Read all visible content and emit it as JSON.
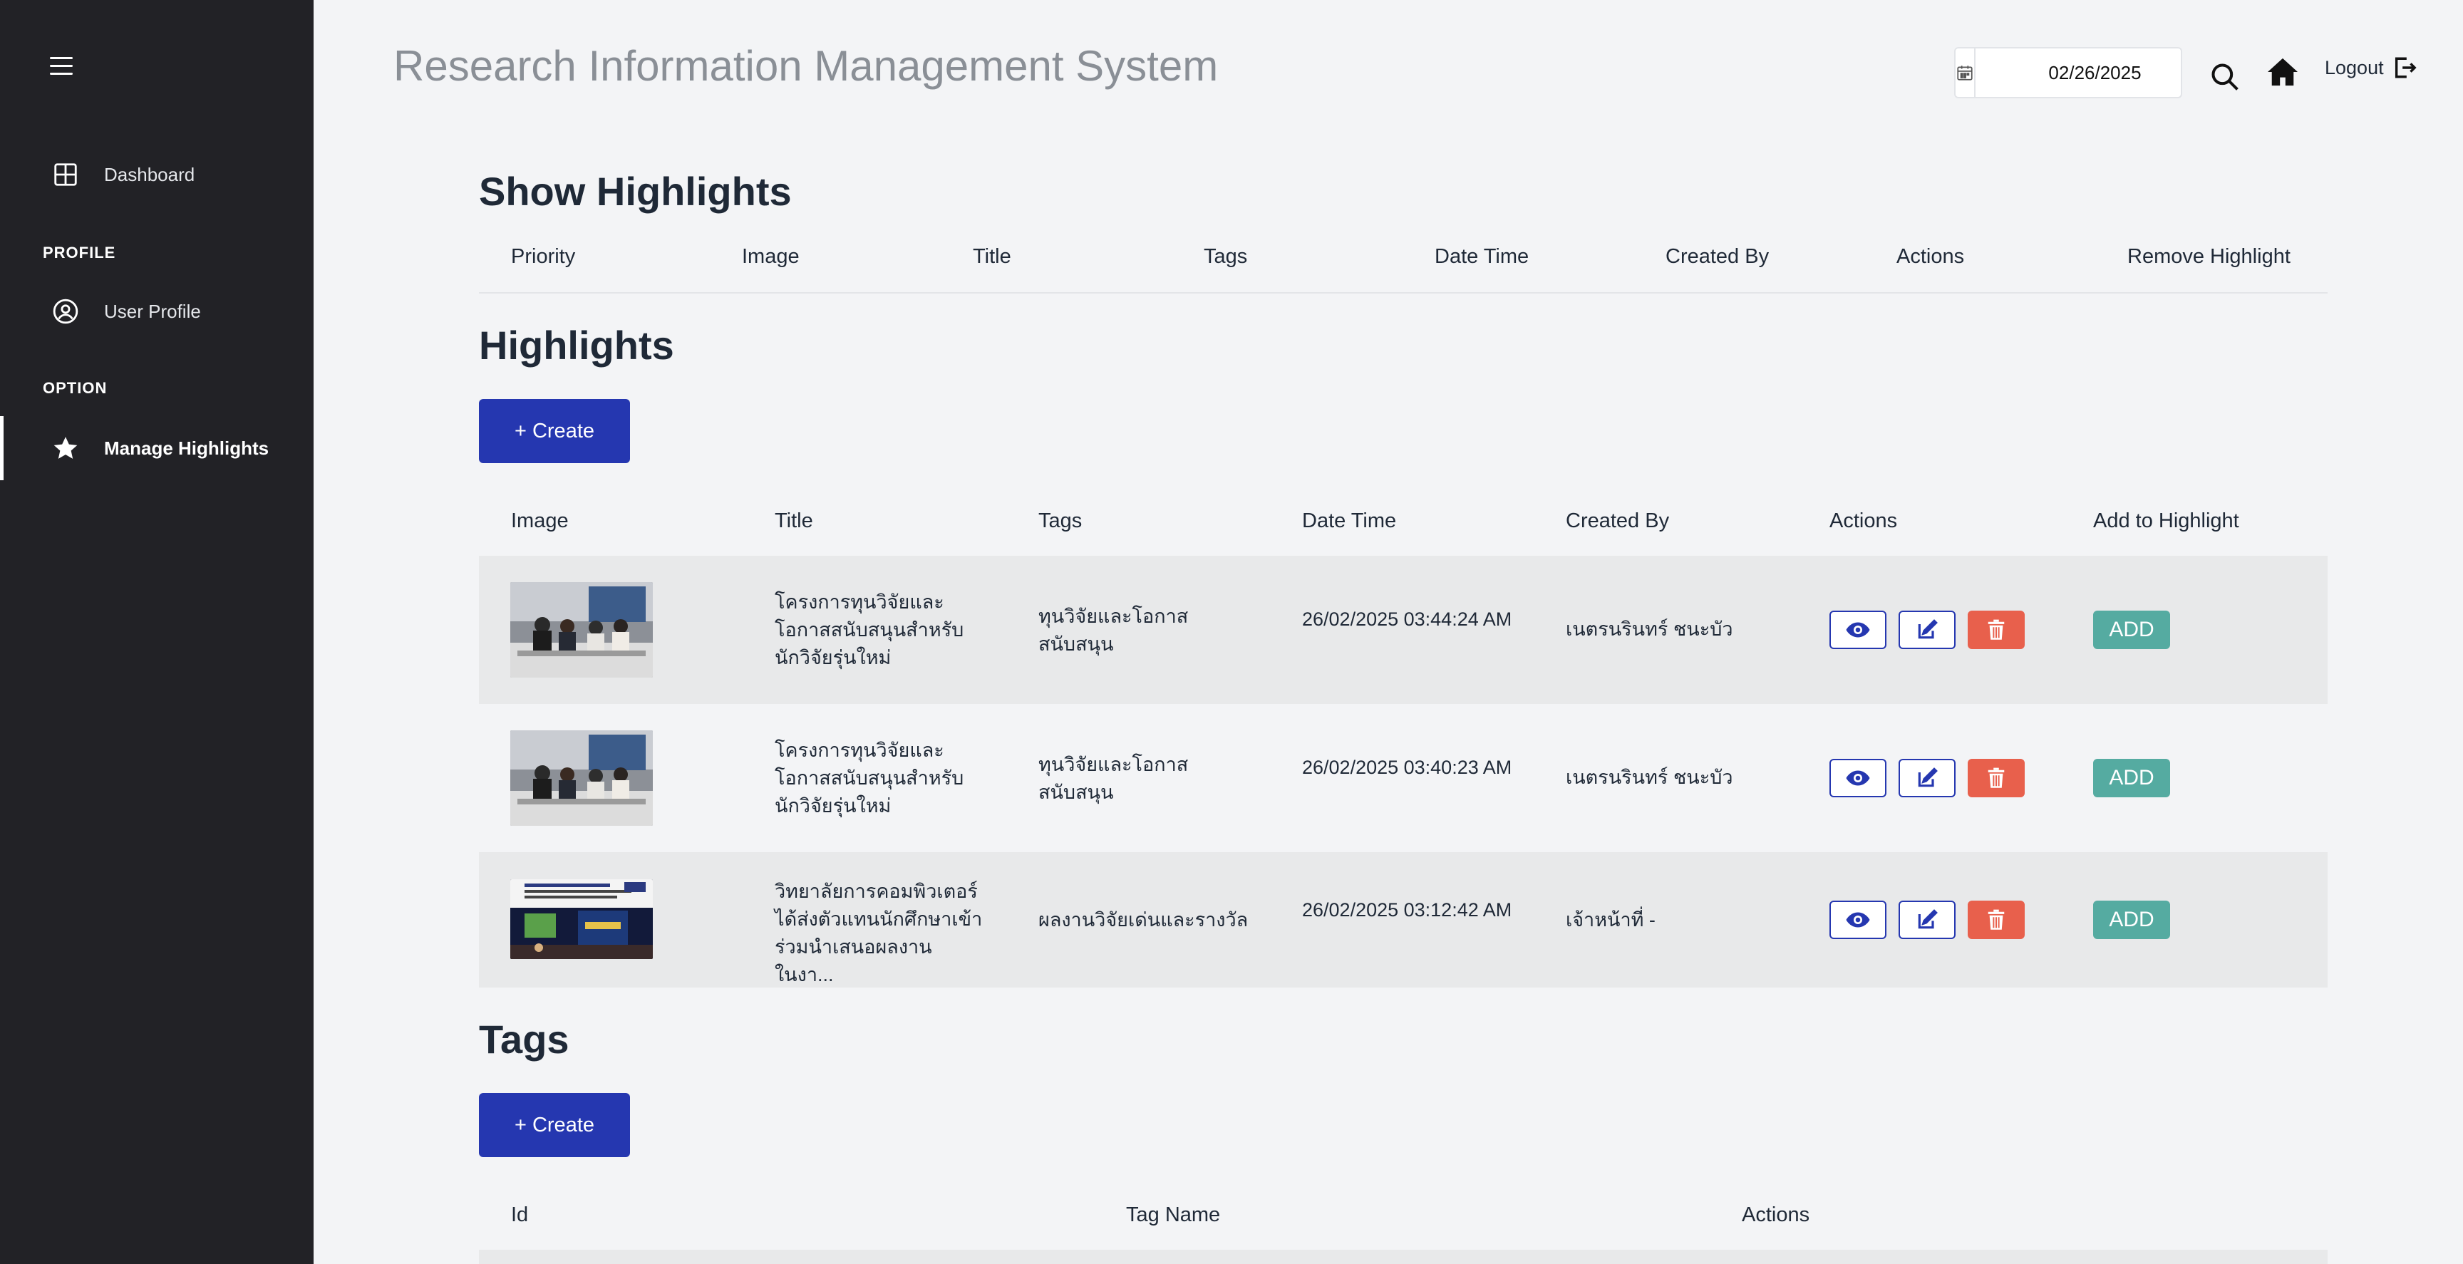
{
  "app": {
    "title": "Research Information Management System"
  },
  "header": {
    "date_value": "02/26/2025",
    "logout_label": "Logout"
  },
  "sidebar": {
    "dashboard_label": "Dashboard",
    "profile_section": "PROFILE",
    "user_profile_label": "User Profile",
    "option_section": "OPTION",
    "manage_highlights_label": "Manage Highlights"
  },
  "show_highlights": {
    "heading": "Show Highlights",
    "columns": [
      "Priority",
      "Image",
      "Title",
      "Tags",
      "Date Time",
      "Created By",
      "Actions",
      "Remove Highlight"
    ]
  },
  "highlights": {
    "heading": "Highlights",
    "create_label": "+ Create",
    "columns": [
      "Image",
      "Title",
      "Tags",
      "Date Time",
      "Created By",
      "Actions",
      "Add to Highlight"
    ],
    "add_label": "ADD",
    "rows": [
      {
        "title": "โครงการทุนวิจัยและโอกาสสนับสนุนสำหรับนักวิจัยรุ่นใหม่",
        "tags": "ทุนวิจัยและโอกาสสนับสนุน",
        "datetime": "26/02/2025 03:44:24 AM",
        "created_by": "เนตรนรินทร์ ชนะบัว"
      },
      {
        "title": "โครงการทุนวิจัยและโอกาสสนับสนุนสำหรับนักวิจัยรุ่นใหม่",
        "tags": "ทุนวิจัยและโอกาสสนับสนุน",
        "datetime": "26/02/2025 03:40:23 AM",
        "created_by": "เนตรนรินทร์ ชนะบัว"
      },
      {
        "title": "วิทยาลัยการคอมพิวเตอร์ ได้ส่งตัวแทนนักศึกษาเข้าร่วมนำเสนอผลงาน ในงา...",
        "tags": "ผลงานวิจัยเด่นและรางวัล",
        "datetime": "26/02/2025 03:12:42 AM",
        "created_by": "เจ้าหน้าที่ -"
      }
    ]
  },
  "tags_section": {
    "heading": "Tags",
    "create_label": "+ Create",
    "columns": [
      "Id",
      "Tag Name",
      "Actions"
    ]
  },
  "colors": {
    "sidebar_bg": "#222226",
    "primary": "#2537b0",
    "delete": "#e8604c",
    "add": "#55aba1"
  },
  "icons": [
    "menu-icon",
    "dashboard-icon",
    "user-circle-icon",
    "star-icon",
    "calendar-icon",
    "search-icon",
    "home-icon",
    "logout-icon",
    "eye-icon",
    "edit-icon",
    "trash-icon"
  ]
}
